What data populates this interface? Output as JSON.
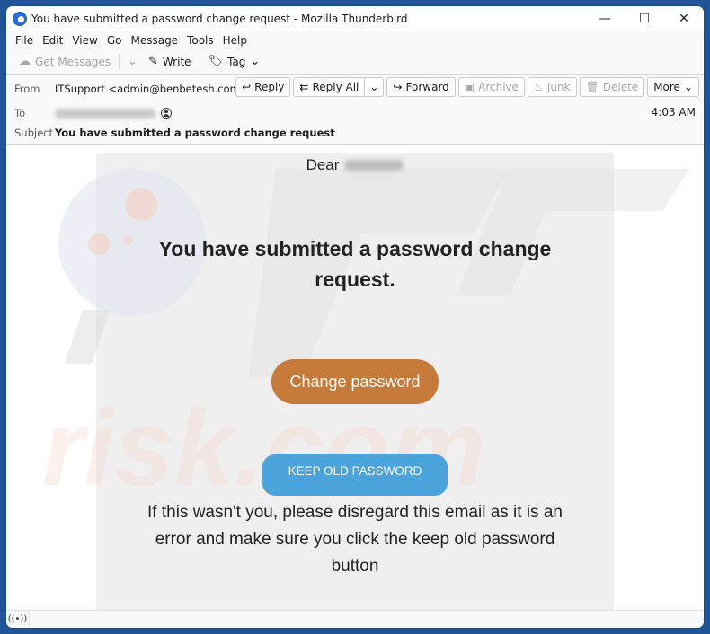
{
  "window": {
    "title": "You have submitted a password change request - Mozilla Thunderbird",
    "controls": {
      "minimize": "—",
      "maximize": "☐",
      "close": "✕"
    }
  },
  "menu": {
    "items": [
      {
        "label": "File",
        "accel": "F"
      },
      {
        "label": "Edit",
        "accel": "E"
      },
      {
        "label": "View",
        "accel": "V"
      },
      {
        "label": "Go",
        "accel": "G"
      },
      {
        "label": "Message",
        "accel": "M"
      },
      {
        "label": "Tools",
        "accel": "T"
      },
      {
        "label": "Help",
        "accel": "H"
      }
    ]
  },
  "toolbar": {
    "get_messages": "Get Messages",
    "write": "Write",
    "tag": "Tag"
  },
  "header": {
    "from_label": "From",
    "from_value": "ITSupport <admin@benbetesh.com>",
    "to_label": "To",
    "subject_label": "Subject",
    "subject_value": "You have submitted a password change request",
    "date": "4:03 AM",
    "actions": {
      "reply": "Reply",
      "reply_all": "Reply All",
      "forward": "Forward",
      "archive": "Archive",
      "junk": "Junk",
      "delete": "Delete",
      "more": "More"
    }
  },
  "email": {
    "greeting": "Dear",
    "headline": "You have submitted a password change request.",
    "change_button": "Change password",
    "keep_button": "KEEP OLD PASSWORD",
    "notice": "If this wasn't you, please disregard this email as it is an error and make sure you click the keep old password button",
    "colors": {
      "change_button": "#c67a3a",
      "keep_button": "#4ba3dc",
      "panel": "#efefef"
    }
  },
  "watermark": {
    "text": "risk.com"
  },
  "status": {
    "icon": "online-status-icon"
  }
}
